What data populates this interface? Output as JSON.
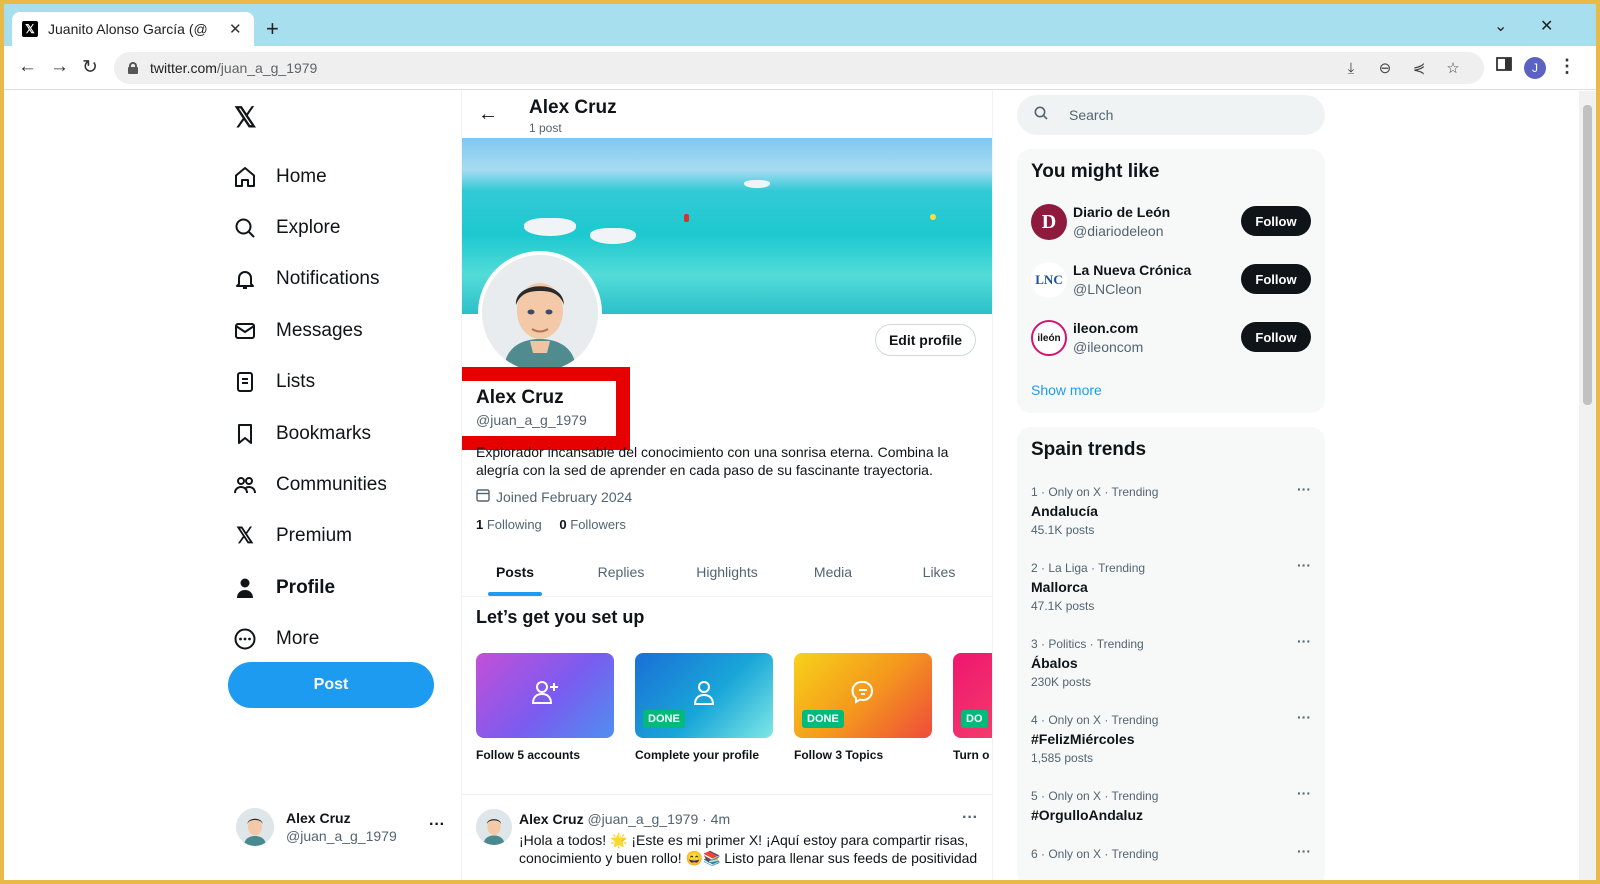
{
  "browser": {
    "tab_title": "Juanito Alonso García (@",
    "url_host": "twitter.com",
    "url_path": "/juan_a_g_1979",
    "profile_initial": "J"
  },
  "nav": {
    "items": [
      {
        "label": "Home",
        "icon": "home-icon"
      },
      {
        "label": "Explore",
        "icon": "search-icon"
      },
      {
        "label": "Notifications",
        "icon": "bell-icon"
      },
      {
        "label": "Messages",
        "icon": "mail-icon"
      },
      {
        "label": "Lists",
        "icon": "list-icon"
      },
      {
        "label": "Bookmarks",
        "icon": "bookmark-icon"
      },
      {
        "label": "Communities",
        "icon": "communities-icon"
      },
      {
        "label": "Premium",
        "icon": "x-logo-icon"
      },
      {
        "label": "Profile",
        "icon": "person-icon"
      },
      {
        "label": "More",
        "icon": "more-circle-icon"
      }
    ],
    "post_button": "Post",
    "account": {
      "name": "Alex Cruz",
      "handle": "@juan_a_g_1979"
    }
  },
  "header": {
    "name": "Alex Cruz",
    "post_count": "1 post"
  },
  "profile": {
    "name": "Alex Cruz",
    "handle": "@juan_a_g_1979",
    "edit_button": "Edit profile",
    "bio": "Explorador incansable del conocimiento con una sonrisa eterna. Combina la alegría con la sed de aprender en cada paso de su fascinante trayectoria.",
    "joined": "Joined February 2024",
    "following_count": "1",
    "following_label": "Following",
    "followers_count": "0",
    "followers_label": "Followers"
  },
  "tabs": [
    "Posts",
    "Replies",
    "Highlights",
    "Media",
    "Likes"
  ],
  "setup": {
    "title": "Let’s get you set up",
    "cards": [
      {
        "label": "Follow 5 accounts",
        "done": ""
      },
      {
        "label": "Complete your profile",
        "done": "DONE"
      },
      {
        "label": "Follow 3 Topics",
        "done": "DONE"
      },
      {
        "label": "Turn o",
        "done": "DO"
      }
    ]
  },
  "tweet": {
    "name": "Alex Cruz",
    "handle": "@juan_a_g_1979",
    "time": "· 4m",
    "text": "¡Hola a todos! 🌟 ¡Este es mi primer X! ¡Aquí estoy para compartir risas, conocimiento y buen rollo! 😄📚 Listo para llenar sus feeds de positividad"
  },
  "search": {
    "placeholder": "Search"
  },
  "suggestions": {
    "title": "You might like",
    "items": [
      {
        "name": "Diario de León",
        "handle": "@diariodeleon",
        "button": "Follow"
      },
      {
        "name": "La Nueva Crónica",
        "handle": "@LNCleon",
        "button": "Follow"
      },
      {
        "name": "ileon.com",
        "handle": "@ileoncom",
        "button": "Follow"
      }
    ],
    "show_more": "Show more"
  },
  "trends": {
    "title": "Spain trends",
    "items": [
      {
        "meta": "1 · Only on X · Trending",
        "name": "Andalucía",
        "posts": "45.1K posts"
      },
      {
        "meta": "2 · La Liga · Trending",
        "name": "Mallorca",
        "posts": "47.1K posts"
      },
      {
        "meta": "3 · Politics · Trending",
        "name": "Ábalos",
        "posts": "230K posts"
      },
      {
        "meta": "4 · Only on X · Trending",
        "name": "#FelizMiércoles",
        "posts": "1,585 posts"
      },
      {
        "meta": "5 · Only on X · Trending",
        "name": "#OrgulloAndaluz",
        "posts": ""
      },
      {
        "meta": "6 · Only on X · Trending",
        "name": "",
        "posts": ""
      }
    ]
  },
  "colors": {
    "accent": "#1d9bf0",
    "highlight_box": "#e60000",
    "done_badge": "#00ba7c"
  }
}
